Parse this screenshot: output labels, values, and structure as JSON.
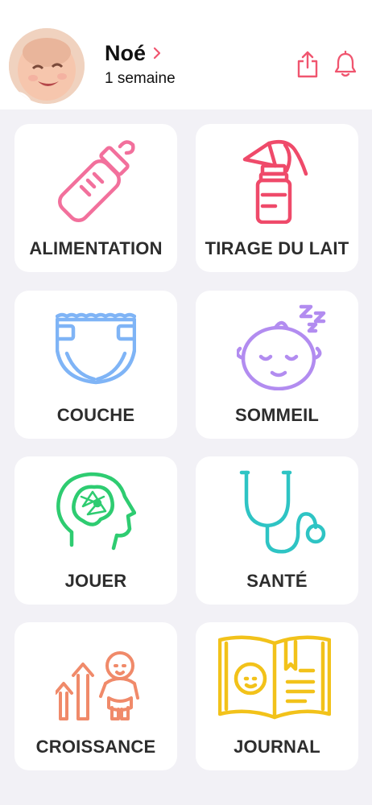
{
  "profile": {
    "name": "Noé",
    "age": "1 semaine"
  },
  "header": {
    "share_icon": "share-icon",
    "bell_icon": "bell-icon",
    "accent_color": "#f0556f"
  },
  "tiles": [
    {
      "label": "ALIMENTATION",
      "icon": "baby-bottle-icon",
      "color": "#f2709c"
    },
    {
      "label": "TIRAGE DU LAIT",
      "icon": "breast-pump-icon",
      "color": "#ef4a6a"
    },
    {
      "label": "COUCHE",
      "icon": "diaper-icon",
      "color": "#7fb4f6"
    },
    {
      "label": "SOMMEIL",
      "icon": "sleeping-baby-icon",
      "color": "#b28cf0"
    },
    {
      "label": "JOUER",
      "icon": "brain-head-icon",
      "color": "#2ecc71"
    },
    {
      "label": "SANTÉ",
      "icon": "stethoscope-icon",
      "color": "#2ec4c4"
    },
    {
      "label": "CROISSANCE",
      "icon": "growth-icon",
      "color": "#f08a6a"
    },
    {
      "label": "JOURNAL",
      "icon": "journal-book-icon",
      "color": "#f2c21a"
    }
  ]
}
